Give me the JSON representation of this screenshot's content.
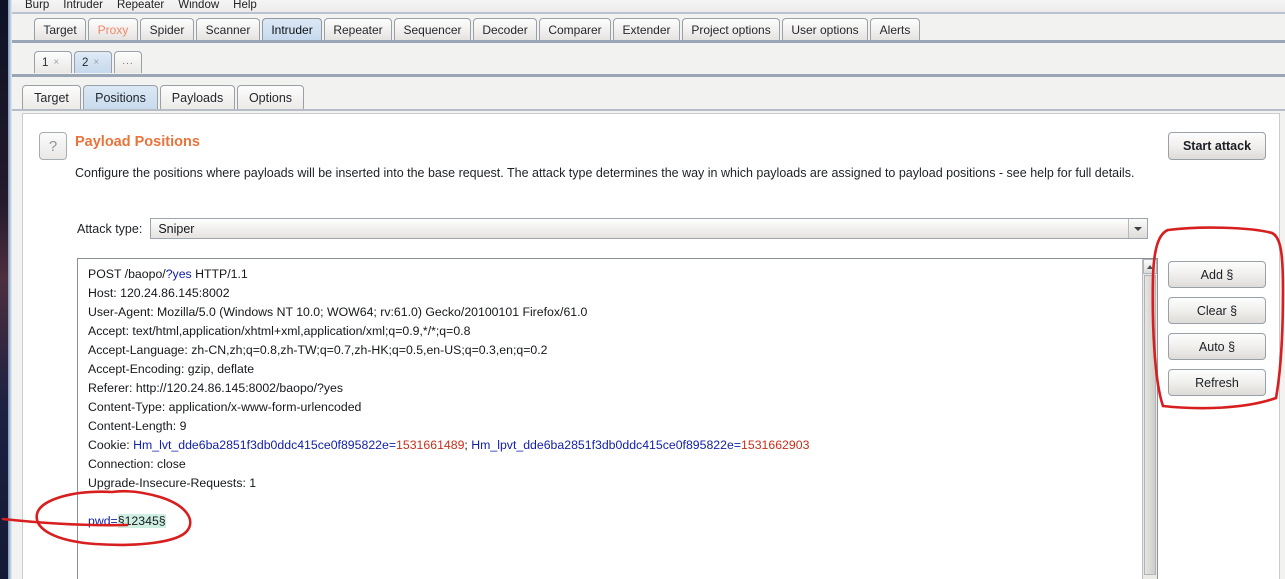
{
  "app": {
    "menu": [
      "Burp",
      "Intruder",
      "Repeater",
      "Window",
      "Help"
    ]
  },
  "main_tabs": [
    {
      "label": "Target",
      "active": false,
      "alerted": false
    },
    {
      "label": "Proxy",
      "active": false,
      "alerted": true
    },
    {
      "label": "Spider",
      "active": false,
      "alerted": false
    },
    {
      "label": "Scanner",
      "active": false,
      "alerted": false
    },
    {
      "label": "Intruder",
      "active": true,
      "alerted": false
    },
    {
      "label": "Repeater",
      "active": false,
      "alerted": false
    },
    {
      "label": "Sequencer",
      "active": false,
      "alerted": false
    },
    {
      "label": "Decoder",
      "active": false,
      "alerted": false
    },
    {
      "label": "Comparer",
      "active": false,
      "alerted": false
    },
    {
      "label": "Extender",
      "active": false,
      "alerted": false
    },
    {
      "label": "Project options",
      "active": false,
      "alerted": false
    },
    {
      "label": "User options",
      "active": false,
      "alerted": false
    },
    {
      "label": "Alerts",
      "active": false,
      "alerted": false
    }
  ],
  "attack_tabs": [
    {
      "label": "1",
      "close": "×",
      "active": false
    },
    {
      "label": "2",
      "close": "×",
      "active": true
    }
  ],
  "attack_tabs_more": "...",
  "inner_tabs": [
    {
      "label": "Target",
      "active": false
    },
    {
      "label": "Positions",
      "active": true
    },
    {
      "label": "Payloads",
      "active": false
    },
    {
      "label": "Options",
      "active": false
    }
  ],
  "panel": {
    "help_glyph": "?",
    "title": "Payload Positions",
    "description": "Configure the positions where payloads will be inserted into the base request. The attack type determines the way in which payloads are assigned to payload positions - see help for full details.",
    "start_attack_label": "Start attack"
  },
  "attack_type": {
    "label": "Attack type:",
    "value": "Sniper"
  },
  "side_buttons": [
    {
      "label": "Add §"
    },
    {
      "label": "Clear §"
    },
    {
      "label": "Auto §"
    },
    {
      "label": "Refresh"
    }
  ],
  "request": {
    "lines": [
      [
        {
          "t": "POST /baopo/",
          "c": "plain"
        },
        {
          "t": "?yes",
          "c": "blue"
        },
        {
          "t": " HTTP/1.1",
          "c": "plain"
        }
      ],
      [
        {
          "t": "Host: 120.24.86.145:8002",
          "c": "plain"
        }
      ],
      [
        {
          "t": "User-Agent: Mozilla/5.0 (Windows NT 10.0; WOW64; rv:61.0) Gecko/20100101 Firefox/61.0",
          "c": "plain"
        }
      ],
      [
        {
          "t": "Accept: text/html,application/xhtml+xml,application/xml;q=0.9,*/*;q=0.8",
          "c": "plain"
        }
      ],
      [
        {
          "t": "Accept-Language: zh-CN,zh;q=0.8,zh-TW;q=0.7,zh-HK;q=0.5,en-US;q=0.3,en;q=0.2",
          "c": "plain"
        }
      ],
      [
        {
          "t": "Accept-Encoding: gzip, deflate",
          "c": "plain"
        }
      ],
      [
        {
          "t": "Referer: http://120.24.86.145:8002/baopo/?yes",
          "c": "plain"
        }
      ],
      [
        {
          "t": "Content-Type: application/x-www-form-urlencoded",
          "c": "plain"
        }
      ],
      [
        {
          "t": "Content-Length: 9",
          "c": "plain"
        }
      ],
      [
        {
          "t": "Cookie: ",
          "c": "plain"
        },
        {
          "t": "Hm_lvt_dde6ba2851f3db0ddc415ce0f895822e=",
          "c": "blue"
        },
        {
          "t": "1531661489",
          "c": "red"
        },
        {
          "t": "; ",
          "c": "plain"
        },
        {
          "t": "Hm_lpvt_dde6ba2851f3db0ddc415ce0f895822e=",
          "c": "blue"
        },
        {
          "t": "1531662903",
          "c": "red"
        }
      ],
      [
        {
          "t": "Connection: close",
          "c": "plain"
        }
      ],
      [
        {
          "t": "Upgrade-Insecure-Requests: 1",
          "c": "plain"
        }
      ],
      [],
      [
        {
          "t": "pwd=",
          "c": "blue"
        },
        {
          "t": "§12345§",
          "c": "mark"
        }
      ]
    ]
  },
  "annotations": {
    "payload_circle": "red-ellipse-around-payload-position",
    "buttons_box": "red-box-around-payload-buttons"
  },
  "colors": {
    "accent_orange": "#e8743b",
    "annotation_red": "#d81f1f",
    "tab_active_blue": "#c8dbee",
    "token_blue": "#1321a8",
    "token_red": "#c8301b",
    "payload_highlight": "#cfeee2"
  }
}
